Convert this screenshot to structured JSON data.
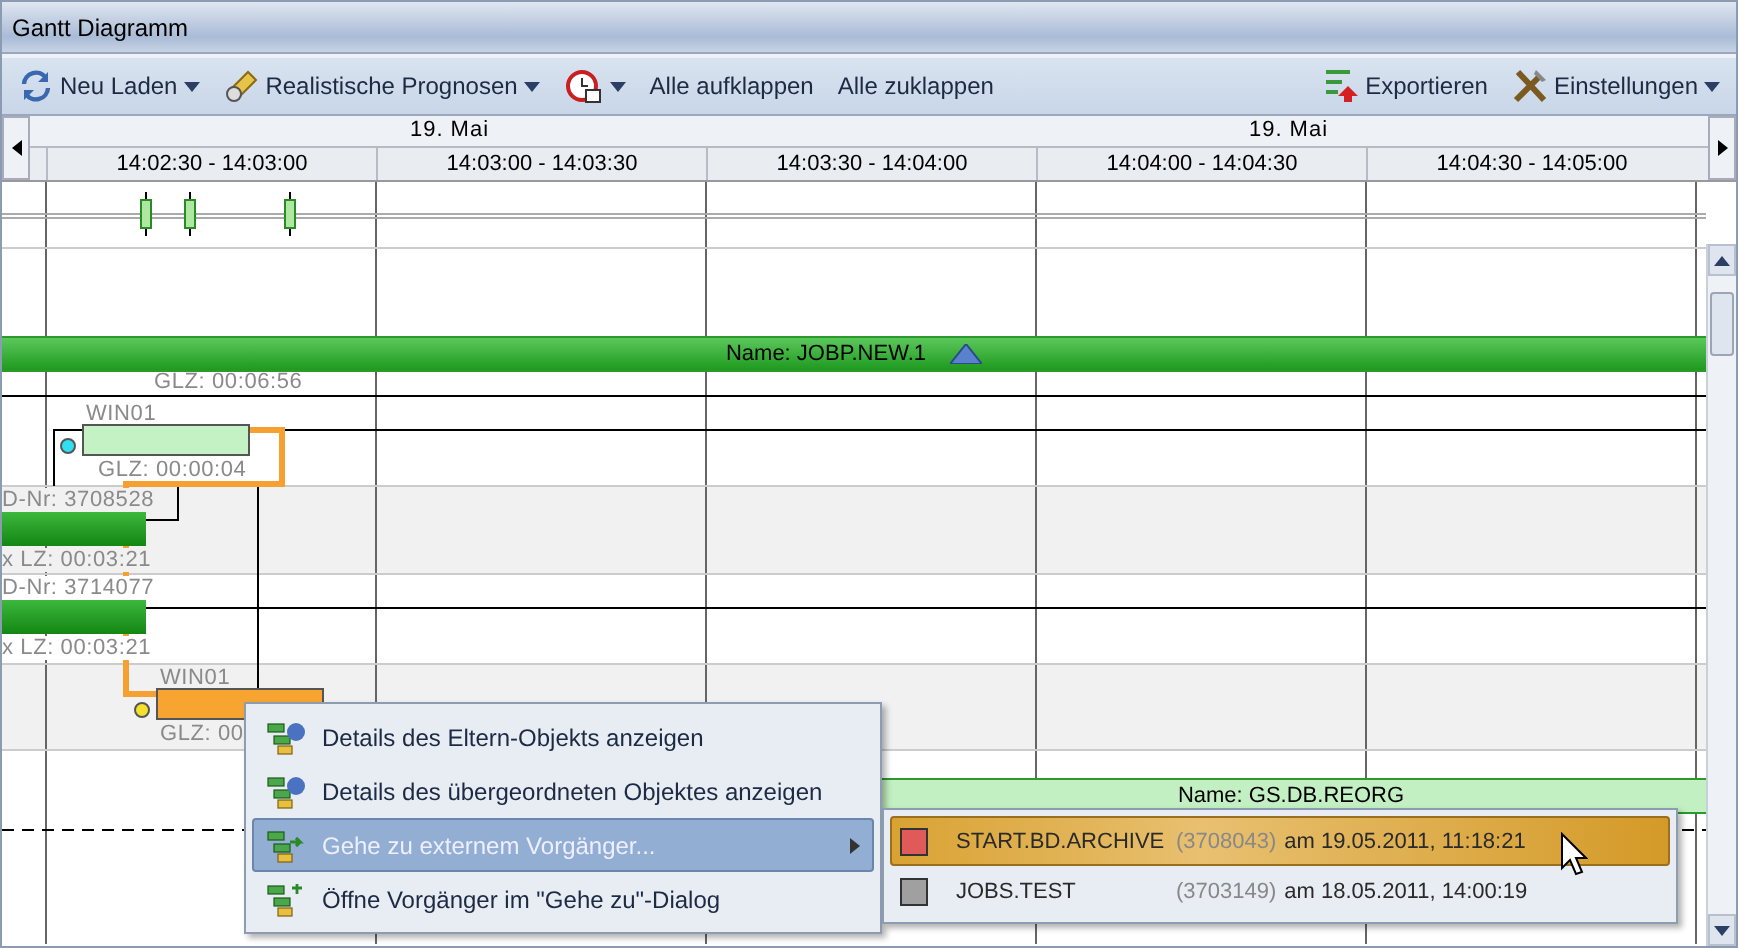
{
  "window": {
    "title": "Gantt Diagramm"
  },
  "toolbar": {
    "left": [
      {
        "label": "Neu Laden",
        "dropdown": true
      },
      {
        "label": "Realistische Prognosen",
        "dropdown": true
      },
      {
        "dropdown": true
      },
      {
        "label": "Alle aufklappen",
        "dropdown": false
      },
      {
        "label": "Alle zuklappen",
        "dropdown": false
      }
    ],
    "right": [
      {
        "label": "Exportieren",
        "dropdown": false
      },
      {
        "label": "Einstellungen",
        "dropdown": true
      }
    ]
  },
  "timeline": {
    "dates": [
      "19. Mai",
      "19. Mai"
    ],
    "columns": [
      "14:02:30 - 14:03:00",
      "14:03:00 - 14:03:30",
      "14:03:30 - 14:04:00",
      "14:04:00 - 14:04:30",
      "14:04:30 - 14:05:00"
    ]
  },
  "gantt": {
    "group": {
      "label": "Name: JOBP.NEW.1",
      "duration": "GLZ: 00:06:56"
    },
    "tasks": [
      {
        "kind": "box",
        "color": "#c5f2c5",
        "host": "WIN01",
        "duration": "GLZ: 00:00:04"
      },
      {
        "kind": "bar",
        "id": "D-Nr: 3708528",
        "duration": "x LZ: 00:03:21"
      },
      {
        "kind": "bar",
        "id": "D-Nr: 3714077",
        "duration": "x LZ: 00:03:21"
      },
      {
        "kind": "box",
        "color": "#f7a530",
        "host": "WIN01",
        "duration": "GLZ: 00"
      }
    ],
    "group2": {
      "label": "Name: GS.DB.REORG"
    }
  },
  "context_menu": [
    {
      "label": "Details des Eltern-Objekts anzeigen",
      "selected": false,
      "submenu": false
    },
    {
      "label": "Details des übergeordneten Objektes anzeigen",
      "selected": false,
      "submenu": false
    },
    {
      "label": "Gehe zu externem Vorgänger...",
      "selected": true,
      "submenu": true
    },
    {
      "label": "Öffne Vorgänger im \"Gehe zu\"-Dialog",
      "selected": false,
      "submenu": false
    }
  ],
  "submenu": [
    {
      "name": "START.BD.ARCHIVE",
      "number": "(3708043)",
      "date": "am 19.05.2011, 11:18:21",
      "color": "#e05a5a",
      "selected": true
    },
    {
      "name": "JOBS.TEST",
      "number": "(3703149)",
      "date": "am 18.05.2011, 14:00:19",
      "color": "#a0a0a0",
      "selected": false
    }
  ]
}
